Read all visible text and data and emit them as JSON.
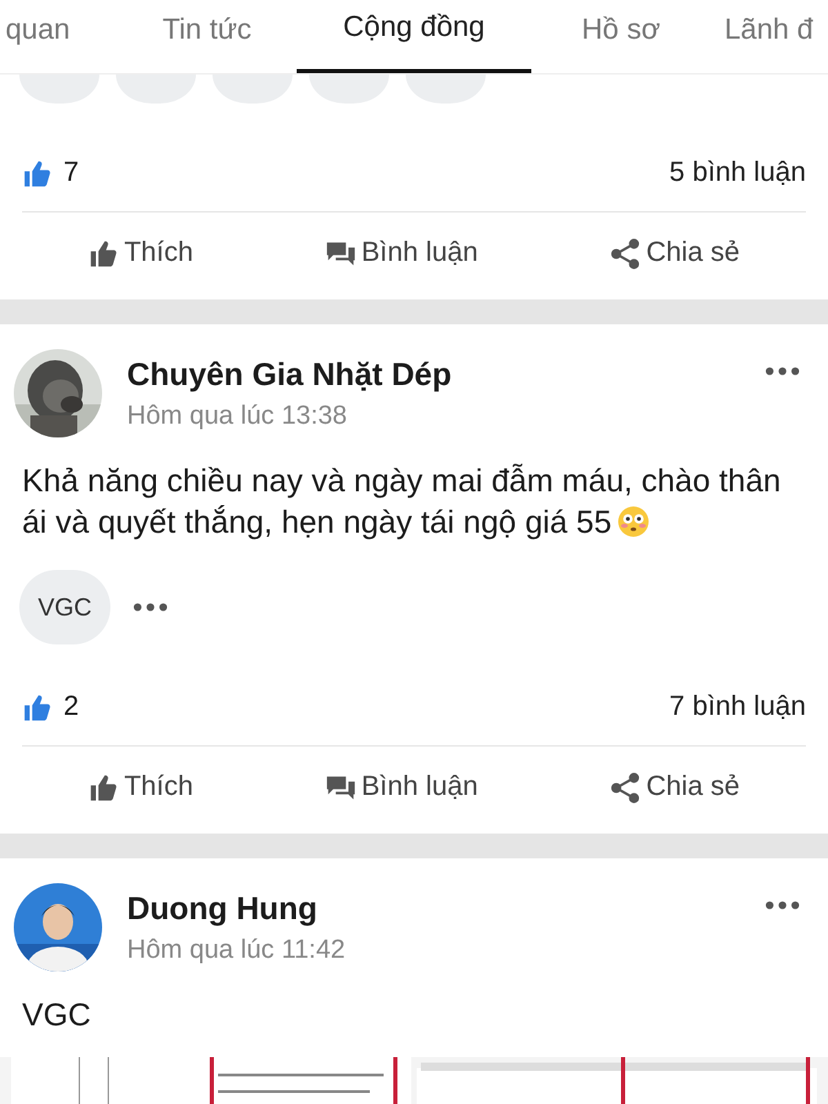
{
  "tabs": [
    {
      "label": "quan",
      "selected": false
    },
    {
      "label": "Tin tức",
      "selected": false
    },
    {
      "label": "Cộng đồng",
      "selected": true
    },
    {
      "label": "Hồ sơ",
      "selected": false
    },
    {
      "label": "Lãnh đ",
      "selected": false
    }
  ],
  "posts": [
    {
      "likes": "7",
      "comments": "5 bình luận",
      "actions": [
        {
          "kind": "like",
          "label": "Thích"
        },
        {
          "kind": "comment",
          "label": "Bình luận"
        },
        {
          "kind": "share",
          "label": "Chia sẻ"
        }
      ]
    },
    {
      "author": "Chuyên Gia Nhặt Dép",
      "time": "Hôm qua lúc 13:38",
      "body": "Khả năng chiều nay và ngày mai đẫm máu, chào thân ái và quyết thắng, hẹn ngày tái ngộ giá 55",
      "emoji": true,
      "tags": [
        "VGC"
      ],
      "tag_more": true,
      "likes": "2",
      "comments": "7 bình luận",
      "actions": [
        {
          "kind": "like",
          "label": "Thích"
        },
        {
          "kind": "comment",
          "label": "Bình luận"
        },
        {
          "kind": "share",
          "label": "Chia sẻ"
        }
      ]
    },
    {
      "author": "Duong Hung",
      "time": "Hôm qua lúc 11:42",
      "body": "VGC"
    }
  ]
}
